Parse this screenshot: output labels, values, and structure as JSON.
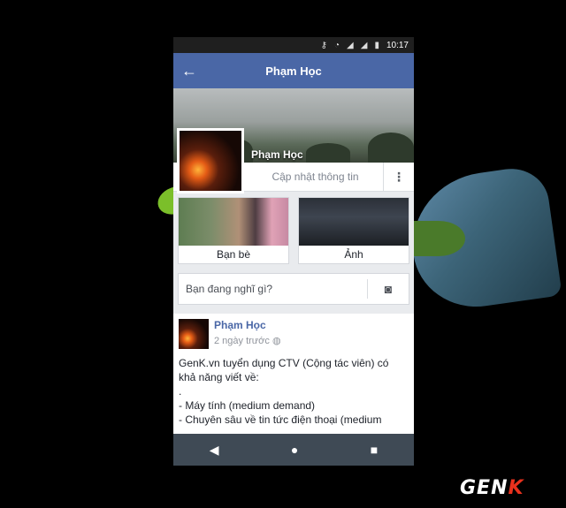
{
  "status": {
    "time": "10:17",
    "icons": [
      "key-icon",
      "wifi-icon",
      "signal-icon",
      "signal-icon",
      "battery-icon"
    ]
  },
  "header": {
    "title": "Phạm Học",
    "back_icon": "arrow-left-icon"
  },
  "profile": {
    "name": "Phạm Học",
    "update_label": "Cập nhật thông tin"
  },
  "tiles": [
    {
      "label": "Bạn bè"
    },
    {
      "label": "Ảnh"
    }
  ],
  "composer": {
    "placeholder": "Bạn đang nghĩ gì?"
  },
  "post": {
    "author": "Phạm Học",
    "time": "2 ngày trước",
    "text": "GenK.vn tuyển dụng CTV (Cộng tác viên) có khả năng viết về:\n.\n- Máy tính (medium demand)\n- Chuyên sâu về tin tức điện thoại (medium"
  },
  "watermark": {
    "text_a": "GEN",
    "text_b": "K"
  },
  "colors": {
    "brand": "#4a67a6",
    "navbar": "#3f4a55"
  }
}
